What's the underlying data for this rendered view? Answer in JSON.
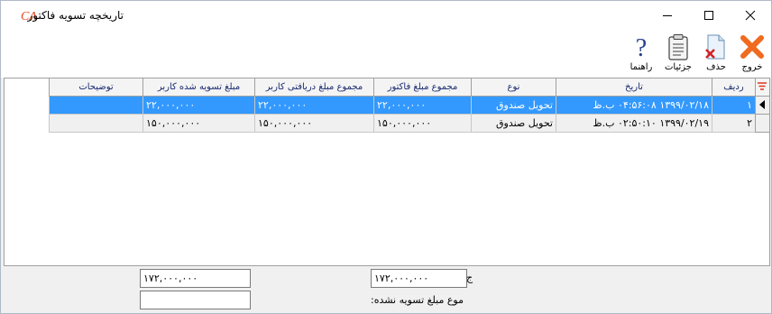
{
  "window": {
    "title": "تاریخچه تسویه فاکتور",
    "logo_text": "CA",
    "accent": "#e8461e"
  },
  "toolbar": {
    "exit_label": "خروج",
    "delete_label": "حذف",
    "details_label": "جزئیات",
    "help_label": "راهنما"
  },
  "grid": {
    "columns": {
      "row_no": "ردیف",
      "date": "تاریخ",
      "type": "نوع",
      "invoice_total": "مجموع مبلغ فاکتور",
      "received_total": "مجموع مبلغ دریافتی کاربر",
      "settled_amount": "مبلغ تسویه شده کاربر",
      "notes": "توضیحات"
    },
    "rows": [
      {
        "row_no": "۱",
        "date": "۱۳۹۹/۰۲/۱۸ ۰۴:۵۶:۰۸ ب.ظ",
        "type": "تحویل صندوق",
        "invoice_total": "۲۲,۰۰۰,۰۰۰",
        "received_total": "۲۲,۰۰۰,۰۰۰",
        "settled_amount": "۲۲,۰۰۰,۰۰۰",
        "notes": ""
      },
      {
        "row_no": "۲",
        "date": "۱۳۹۹/۰۲/۱۹ ۰۲:۵۰:۱۰ ب.ظ",
        "type": "تحویل صندوق",
        "invoice_total": "۱۵۰,۰۰۰,۰۰۰",
        "received_total": "۱۵۰,۰۰۰,۰۰۰",
        "settled_amount": "۱۵۰,۰۰۰,۰۰۰",
        "notes": ""
      }
    ],
    "selected_color": "#3399ff"
  },
  "footer": {
    "total_label": "ج",
    "total_value": "۱۷۲,۰۰۰,۰۰۰",
    "settled_sum_value": "۱۷۲,۰۰۰,۰۰۰",
    "unsettled_label": "موع مبلغ تسویه نشده:",
    "unsettled_value": ""
  }
}
